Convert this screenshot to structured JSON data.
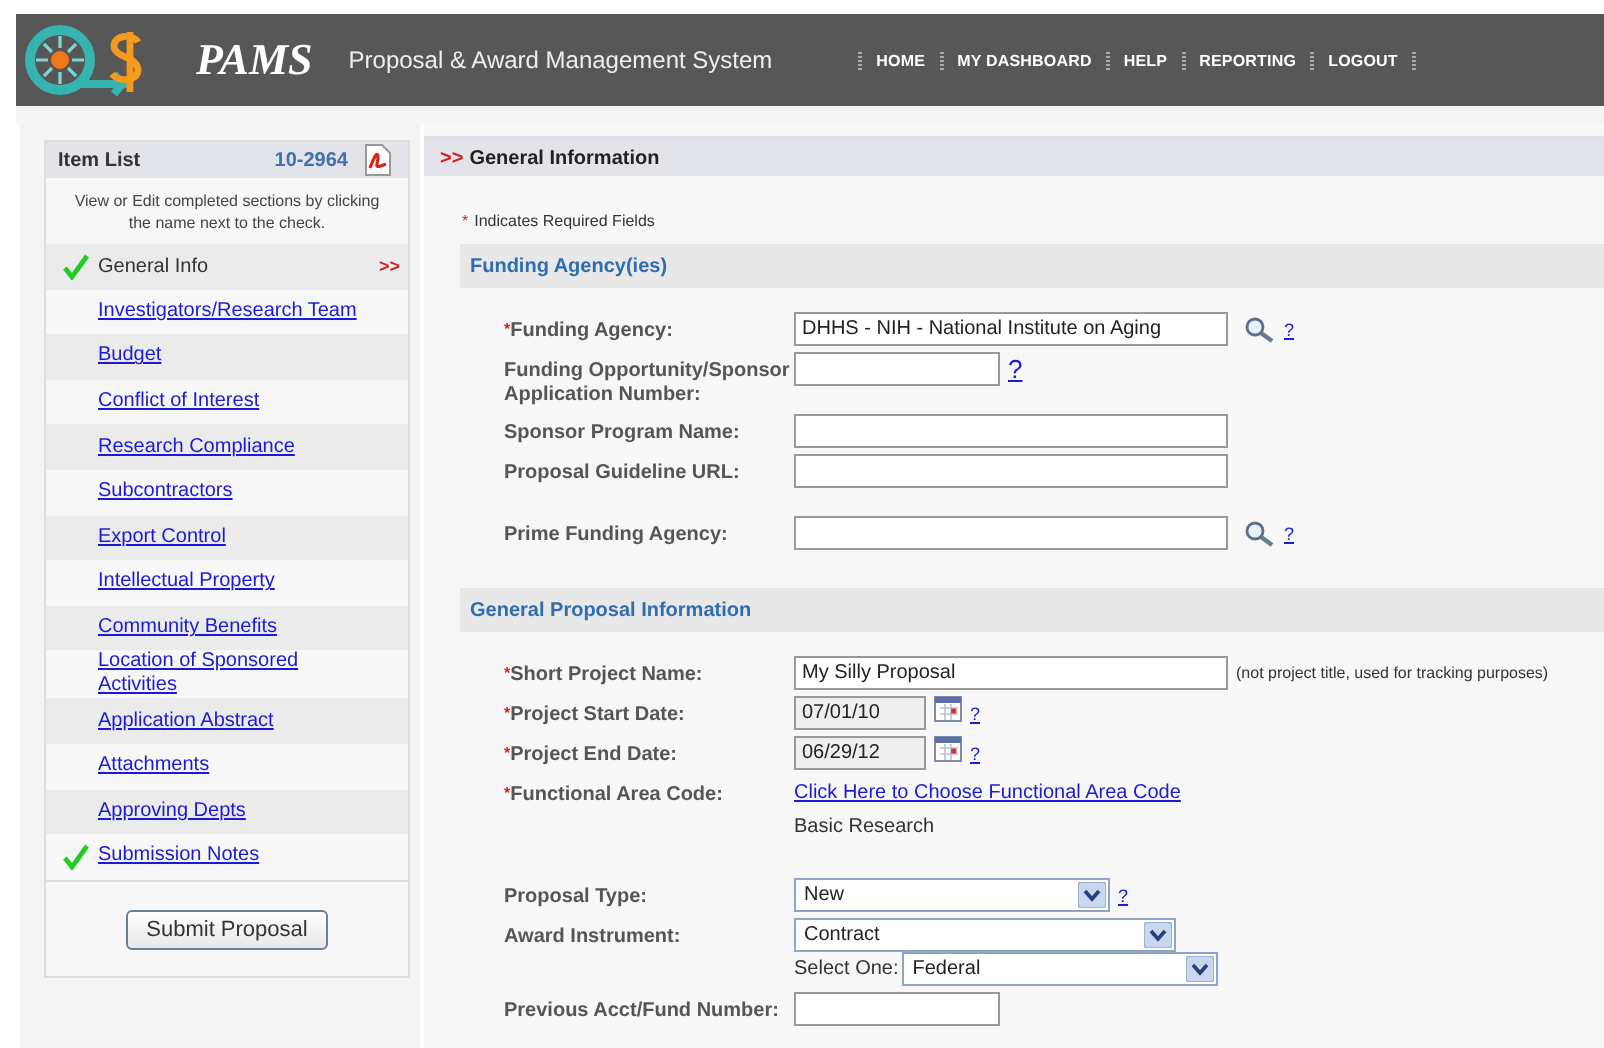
{
  "header": {
    "app_name": "PAMS",
    "subtitle": "Proposal & Award Management System",
    "nav": [
      "HOME",
      "MY DASHBOARD",
      "HELP",
      "REPORTING",
      "LOGOUT"
    ]
  },
  "sidebar": {
    "title": "Item List",
    "number": "10-2964",
    "hint": "View or Edit completed sections by clicking the name next to the check.",
    "current_marker": ">>",
    "items": [
      {
        "label": "General Info",
        "checked": true,
        "selected": true
      },
      {
        "label": "Investigators/Research Team",
        "checked": false,
        "selected": false
      },
      {
        "label": "Budget",
        "checked": false,
        "selected": false
      },
      {
        "label": "Conflict of Interest",
        "checked": false,
        "selected": false
      },
      {
        "label": "Research Compliance",
        "checked": false,
        "selected": false
      },
      {
        "label": "Subcontractors",
        "checked": false,
        "selected": false
      },
      {
        "label": "Export Control",
        "checked": false,
        "selected": false
      },
      {
        "label": "Intellectual Property",
        "checked": false,
        "selected": false
      },
      {
        "label": "Community Benefits",
        "checked": false,
        "selected": false
      },
      {
        "label": "Location of Sponsored Activities",
        "checked": false,
        "selected": false
      },
      {
        "label": "Application Abstract",
        "checked": false,
        "selected": false
      },
      {
        "label": "Attachments",
        "checked": false,
        "selected": false
      },
      {
        "label": "Approving Depts",
        "checked": false,
        "selected": false
      },
      {
        "label": "Submission Notes",
        "checked": true,
        "selected": false
      }
    ],
    "submit_button": "Submit Proposal"
  },
  "main": {
    "marker": ">>",
    "title": "General Information",
    "required_star": "*",
    "required_note": "Indicates Required Fields",
    "help_mark": "?",
    "sections": [
      {
        "title": "Funding Agency(ies)",
        "fields": [
          {
            "kind": "text",
            "label": "Funding Agency:",
            "required": true,
            "value": "DHHS - NIH - National Institute on Aging",
            "short": false,
            "lookup": true,
            "help": true
          },
          {
            "kind": "text",
            "label": "Funding Opportunity/Sponsor Application Number:",
            "required": false,
            "short": true,
            "lookup": false,
            "help": true
          },
          {
            "kind": "text",
            "label": "Sponsor Program Name:",
            "required": false,
            "short": false,
            "lookup": false,
            "help": false
          },
          {
            "kind": "text",
            "label": "Proposal Guideline URL:",
            "required": false,
            "short": false,
            "lookup": false,
            "help": false
          },
          {
            "kind": "text",
            "label": "Prime Funding Agency:",
            "required": false,
            "short": false,
            "lookup": true,
            "help": true
          }
        ]
      },
      {
        "title": "General Proposal Information",
        "fields": [
          {
            "kind": "text",
            "label": "Short Project Name:",
            "required": true,
            "value": "My Silly Proposal",
            "short": false,
            "lookup": false,
            "help": false,
            "note": "(not project title, used for tracking purposes)"
          },
          {
            "kind": "date",
            "label": "Project Start Date:",
            "required": true,
            "value": "07/01/10",
            "help": true
          },
          {
            "kind": "date",
            "label": "Project End Date:",
            "required": true,
            "value": "06/29/12",
            "help": true
          },
          {
            "kind": "link",
            "label": "Functional Area Code:",
            "required": true,
            "link": "Click Here to Choose Functional Area Code",
            "value": "Basic Research"
          },
          {
            "kind": "select",
            "label": "Proposal Type:",
            "required": false,
            "value": "New",
            "wide": false,
            "help": true
          },
          {
            "kind": "select",
            "label": "Award Instrument:",
            "required": false,
            "value": "Contract",
            "wide": true,
            "help": false,
            "sub_label": "Select One:",
            "sub_value": "Federal"
          },
          {
            "kind": "text",
            "label": "Previous Acct/Fund Number:",
            "required": false,
            "short": true,
            "lookup": false,
            "help": false
          }
        ]
      }
    ]
  }
}
